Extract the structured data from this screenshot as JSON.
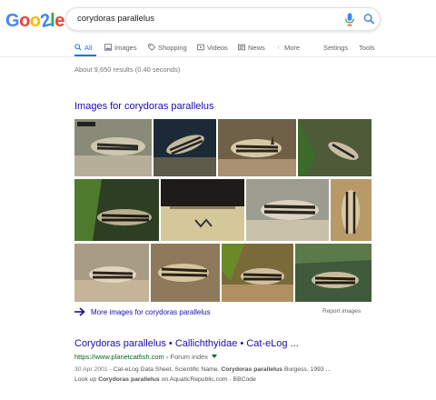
{
  "logo": {
    "letters": [
      "G",
      "o",
      "o",
      "2",
      "l",
      "e"
    ],
    "colors": [
      "#4285f4",
      "#ea4335",
      "#fbbc05",
      "#4285f4",
      "#34a853",
      "#ea4335"
    ]
  },
  "search": {
    "query": "corydoras parallelus",
    "mic_icon": "microphone-icon",
    "search_icon": "magnifier-icon"
  },
  "tabs": [
    {
      "label": "All",
      "icon": "search-icon",
      "active": true
    },
    {
      "label": "Images",
      "icon": "image-icon"
    },
    {
      "label": "Shopping",
      "icon": "tag-icon"
    },
    {
      "label": "Videos",
      "icon": "play-icon"
    },
    {
      "label": "News",
      "icon": "newspaper-icon"
    },
    {
      "label": "More",
      "icon": "more-vert-icon"
    }
  ],
  "tools": {
    "settings": "Settings",
    "tools": "Tools"
  },
  "result_stats": "About 9,650 results (0.40 seconds)",
  "images_section": {
    "heading": "Images for corydoras parallelus",
    "more_link": "More images for corydoras parallelus",
    "report": "Report images"
  },
  "result": {
    "title": "Corydoras parallelus • Callichthyidae • Cat-eLog ...",
    "url": "https://www.planetcatfish.com",
    "breadcrumb": " › Forum index",
    "snippet_date": "30 Apr 2001 - ",
    "snippet_pre": "Cat-eLog Data Sheet. Scientific Name. ",
    "snippet_bold": "Corydoras parallelus",
    "snippet_post": " Burgess, 1993 ...",
    "snippet2_pre": "Look up ",
    "snippet2_bold": "Corydoras parallelus",
    "snippet2_post": " on AquaticRepublic.com · BBCode"
  },
  "colors": {
    "link": "#1a0dab",
    "url": "#006621",
    "accent": "#1a73e8"
  }
}
